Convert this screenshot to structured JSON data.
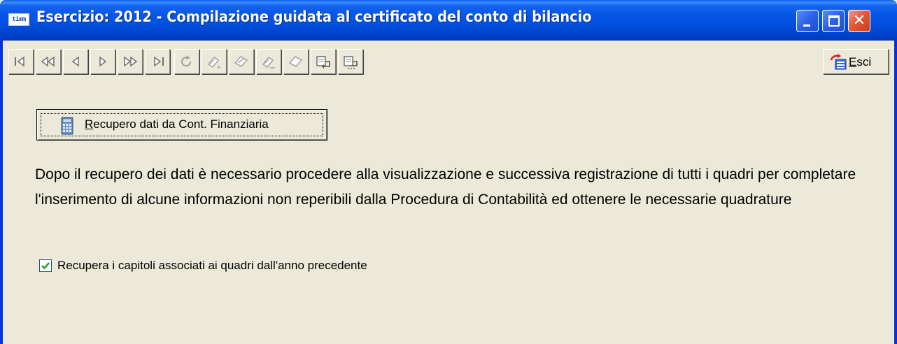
{
  "window": {
    "app_icon_text": "timm",
    "title": "Esercizio: 2012 - Compilazione guidata al certificato del conto di bilancio"
  },
  "toolbar": {
    "buttons": [
      {
        "icon": "first-record-icon"
      },
      {
        "icon": "previous-page-icon"
      },
      {
        "icon": "previous-record-icon"
      },
      {
        "icon": "next-record-icon"
      },
      {
        "icon": "next-page-icon"
      },
      {
        "icon": "last-record-icon"
      },
      {
        "icon": "refresh-icon"
      },
      {
        "icon": "new-record-icon"
      },
      {
        "icon": "edit-record-icon"
      },
      {
        "icon": "delete-record-icon"
      },
      {
        "icon": "save-record-icon"
      },
      {
        "icon": "print-icon"
      },
      {
        "icon": "print-preview-icon"
      }
    ],
    "exit_label_first": "E",
    "exit_label_rest": "sci"
  },
  "recover_button": {
    "label_first": "R",
    "label_rest": "ecupero dati da Cont. Finanziaria"
  },
  "info_text": "Dopo il recupero dei dati è necessario procedere alla visualizzazione  e successiva registrazione di tutti i quadri  per  completare l'inserimento di alcune informazioni non reperibili dalla  Procedura di Contabilità ed ottenere le necessarie quadrature",
  "checkbox": {
    "checked": true,
    "label": "Recupera i capitoli associati ai quadri dall'anno precedente"
  },
  "colors": {
    "titlebar": "#0054e3",
    "face": "#ece9d8",
    "close": "#e2593a"
  }
}
